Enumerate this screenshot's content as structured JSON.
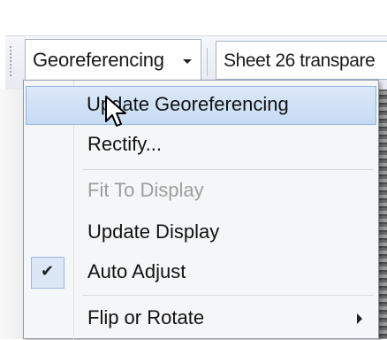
{
  "toolbar": {
    "menu_label": "Georeferencing",
    "layer_value": "Sheet 26 transpare"
  },
  "menu": {
    "items": [
      {
        "label": "Update Georeferencing",
        "state": "highlighted"
      },
      {
        "label": "Rectify...",
        "state": "enabled"
      },
      {
        "label": "Fit To Display",
        "state": "disabled"
      },
      {
        "label": "Update Display",
        "state": "enabled"
      },
      {
        "label": "Auto Adjust",
        "state": "checked"
      },
      {
        "label": "Flip or Rotate",
        "state": "submenu"
      }
    ],
    "check_glyph": "✔"
  },
  "colors": {
    "highlight": "#c6dbf3",
    "disabled_text": "#9d9d9d"
  }
}
